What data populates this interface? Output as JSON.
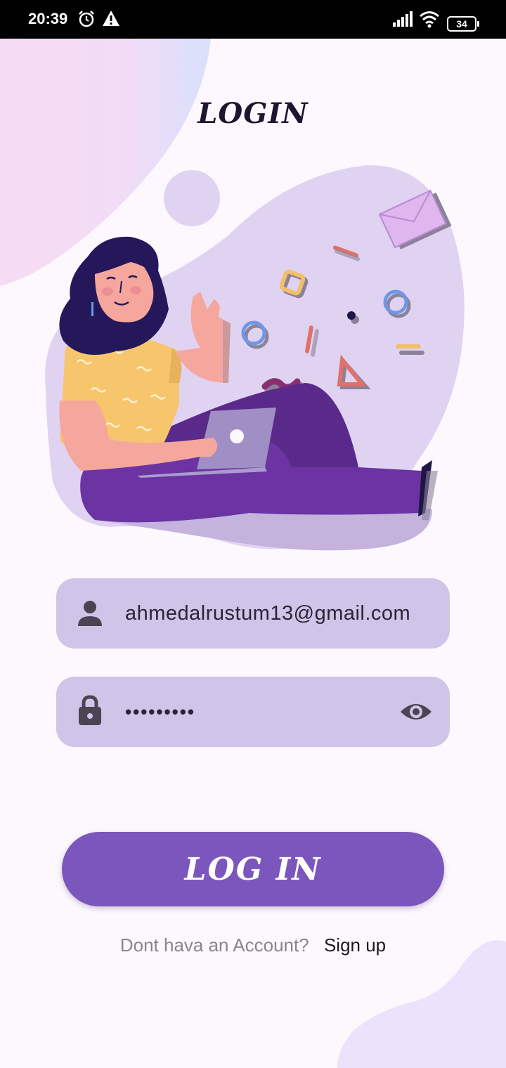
{
  "status_bar": {
    "time": "20:39",
    "icons": [
      "alarm-icon",
      "warning-icon",
      "signal-icon",
      "wifi-icon",
      "battery-icon"
    ],
    "battery": "34"
  },
  "login": {
    "title": "LOGIN",
    "email_value": "ahmedalrustum13@gmail.com",
    "password_value": "•••••••••",
    "login_button": "LOG IN",
    "signup_prompt": "Dont hava an Account?",
    "signup_link": "Sign up"
  },
  "colors": {
    "background": "#fdf8fd",
    "field_background": "#d0c4e8",
    "accent": "#7b56bd",
    "illustration_blob": "#e0d3f2"
  }
}
